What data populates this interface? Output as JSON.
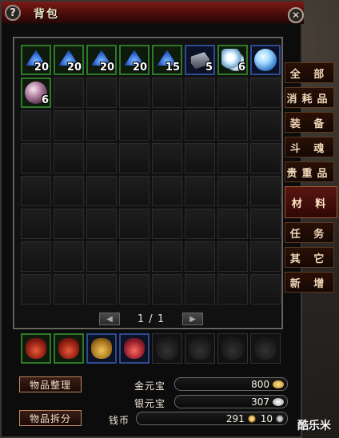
{
  "window": {
    "title": "背包",
    "help_glyph": "?",
    "close_glyph": "✕"
  },
  "bag": {
    "items": [
      {
        "icon": "blue-crystal-icon",
        "count": "20"
      },
      {
        "icon": "blue-crystal-icon",
        "count": "20"
      },
      {
        "icon": "blue-crystal-icon",
        "count": "20"
      },
      {
        "icon": "blue-crystal-icon",
        "count": "20"
      },
      {
        "icon": "blue-crystal-icon",
        "count": "15"
      },
      {
        "icon": "silver-ingot-icon",
        "count": "5"
      },
      {
        "icon": "white-flower-icon",
        "count": "6"
      },
      {
        "icon": "blue-pearl-icon",
        "count": ""
      },
      {
        "icon": "pink-orb-icon",
        "count": "6"
      }
    ],
    "total_slots": 64
  },
  "pager": {
    "prev": "◀",
    "text": "1 / 1",
    "next": "▶"
  },
  "tabs": [
    "全 部",
    "消耗品",
    "装 备",
    "斗 魂",
    "贵重品",
    "材 料",
    "任 务",
    "其 它",
    "新 增"
  ],
  "active_tab": "材 料",
  "equip_bags": [
    {
      "icon": "red-bag-icon",
      "style": "green"
    },
    {
      "icon": "red-bag-icon",
      "style": "green"
    },
    {
      "icon": "gold-bag-icon",
      "style": "blue"
    },
    {
      "icon": "red-bag-icon",
      "style": "blue"
    },
    {
      "icon": "empty-bag-icon",
      "style": ""
    },
    {
      "icon": "empty-bag-icon",
      "style": ""
    },
    {
      "icon": "empty-bag-icon",
      "style": ""
    },
    {
      "icon": "empty-bag-icon",
      "style": ""
    }
  ],
  "actions": {
    "sort": "物品整理",
    "split": "物品拆分"
  },
  "currency": {
    "gold_label": "金元宝",
    "gold_value": "800",
    "silver_label": "银元宝",
    "silver_value": "307",
    "coin_label": "钱币",
    "coin_value_a": "291",
    "coin_value_b": "10"
  },
  "watermark": "酷乐米"
}
